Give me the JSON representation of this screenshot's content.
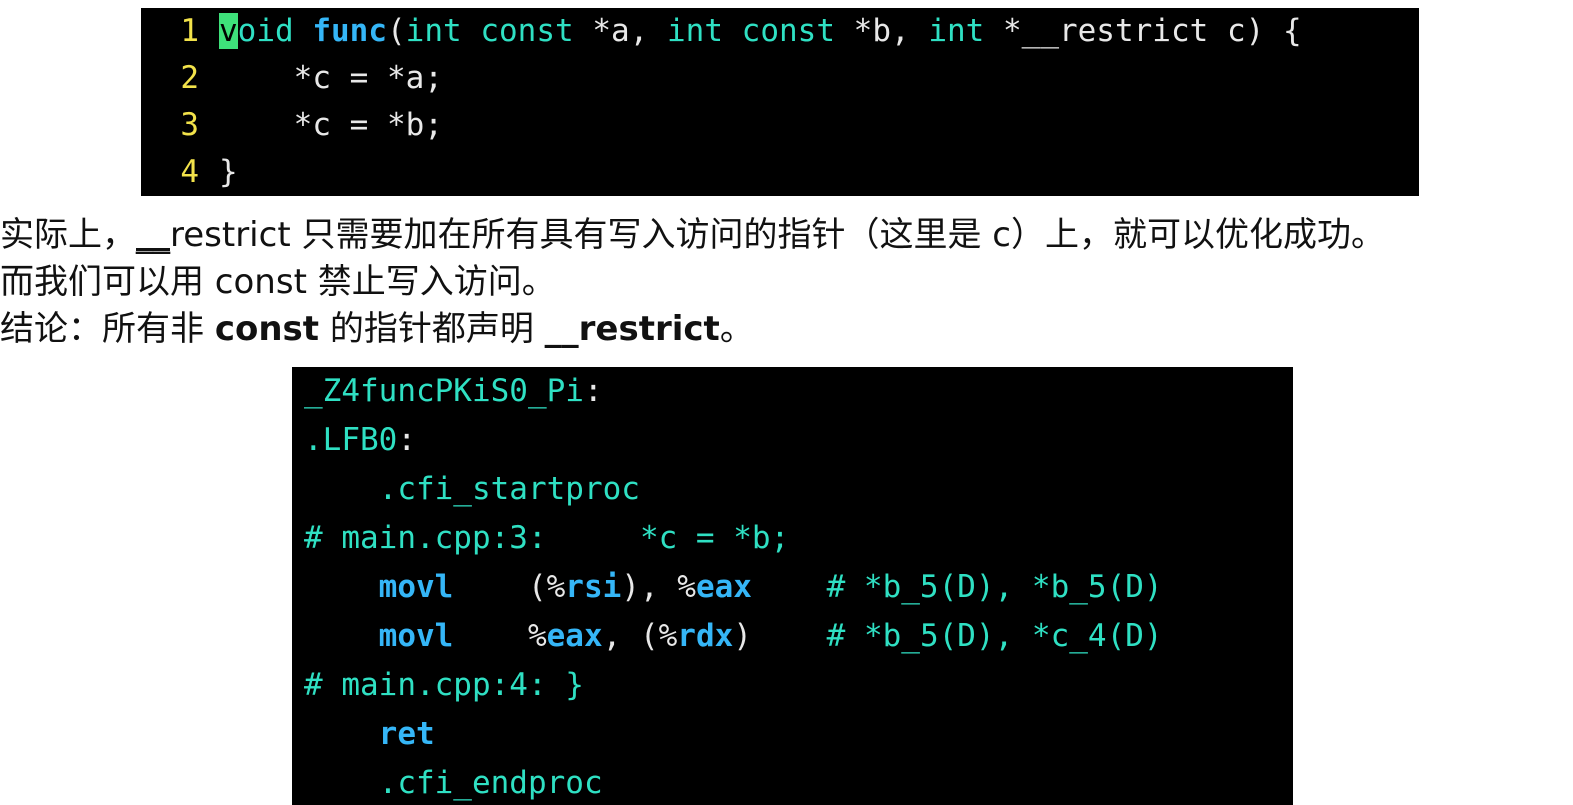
{
  "top_code": {
    "lines": [
      {
        "num": "1",
        "cursor_char": "v",
        "parts": [
          {
            "t": "oid",
            "cls": "tok-kw"
          },
          {
            "t": " ",
            "cls": "tok-op"
          },
          {
            "t": "func",
            "cls": "tok-fn"
          },
          {
            "t": "(",
            "cls": "tok-op"
          },
          {
            "t": "int",
            "cls": "tok-kw"
          },
          {
            "t": " ",
            "cls": "tok-op"
          },
          {
            "t": "const",
            "cls": "tok-kw"
          },
          {
            "t": " *a, ",
            "cls": "tok-op"
          },
          {
            "t": "int",
            "cls": "tok-kw"
          },
          {
            "t": " ",
            "cls": "tok-op"
          },
          {
            "t": "const",
            "cls": "tok-kw"
          },
          {
            "t": " *b, ",
            "cls": "tok-op"
          },
          {
            "t": "int",
            "cls": "tok-kw"
          },
          {
            "t": " *__restrict c) {",
            "cls": "tok-op"
          }
        ]
      },
      {
        "num": "2",
        "parts": [
          {
            "t": "    *c = *a;",
            "cls": "tok-op"
          }
        ]
      },
      {
        "num": "3",
        "parts": [
          {
            "t": "    *c = *b;",
            "cls": "tok-op"
          }
        ]
      },
      {
        "num": "4",
        "parts": [
          {
            "t": "}",
            "cls": "tok-op"
          }
        ]
      }
    ]
  },
  "prose": {
    "line1_a": "实际上，",
    "line1_b": "__",
    "line1_c": "restrict 只需要加在所有具有写入访问的指针（这里是 c）上，就可以优化成功。",
    "line2": "而我们可以用 const 禁止写入访问。",
    "line3_a": "结论：所有非 ",
    "line3_b": "const",
    "line3_c": " 的指针都声明 ",
    "line3_d": "__restrict",
    "line3_e": "。"
  },
  "asm": {
    "lines": [
      [
        {
          "t": "_Z4funcPKiS0_Pi",
          "cls": "asm-label"
        },
        {
          "t": ":",
          "cls": "asm-plain"
        }
      ],
      [
        {
          "t": ".LFB0",
          "cls": "asm-label"
        },
        {
          "t": ":",
          "cls": "asm-plain"
        }
      ],
      [
        {
          "t": "    .cfi_startproc",
          "cls": "asm-dir"
        }
      ],
      [
        {
          "t": "# main.cpp:3:     *c = *b;",
          "cls": "asm-cmt"
        }
      ],
      [
        {
          "t": "    ",
          "cls": "asm-plain"
        },
        {
          "t": "movl",
          "cls": "asm-ins"
        },
        {
          "t": "    (%",
          "cls": "asm-plain"
        },
        {
          "t": "rsi",
          "cls": "asm-reg"
        },
        {
          "t": "), %",
          "cls": "asm-plain"
        },
        {
          "t": "eax",
          "cls": "asm-reg"
        },
        {
          "t": "    ",
          "cls": "asm-plain"
        },
        {
          "t": "# *b_5(D), *b_5(D)",
          "cls": "asm-cmt"
        }
      ],
      [
        {
          "t": "    ",
          "cls": "asm-plain"
        },
        {
          "t": "movl",
          "cls": "asm-ins"
        },
        {
          "t": "    %",
          "cls": "asm-plain"
        },
        {
          "t": "eax",
          "cls": "asm-reg"
        },
        {
          "t": ", (%",
          "cls": "asm-plain"
        },
        {
          "t": "rdx",
          "cls": "asm-reg"
        },
        {
          "t": ")    ",
          "cls": "asm-plain"
        },
        {
          "t": "# *b_5(D), *c_4(D)",
          "cls": "asm-cmt"
        }
      ],
      [
        {
          "t": "# main.cpp:4: }",
          "cls": "asm-cmt"
        }
      ],
      [
        {
          "t": "    ",
          "cls": "asm-plain"
        },
        {
          "t": "ret",
          "cls": "asm-ins"
        }
      ],
      [
        {
          "t": "    .cfi_endproc",
          "cls": "asm-dir"
        }
      ]
    ]
  }
}
